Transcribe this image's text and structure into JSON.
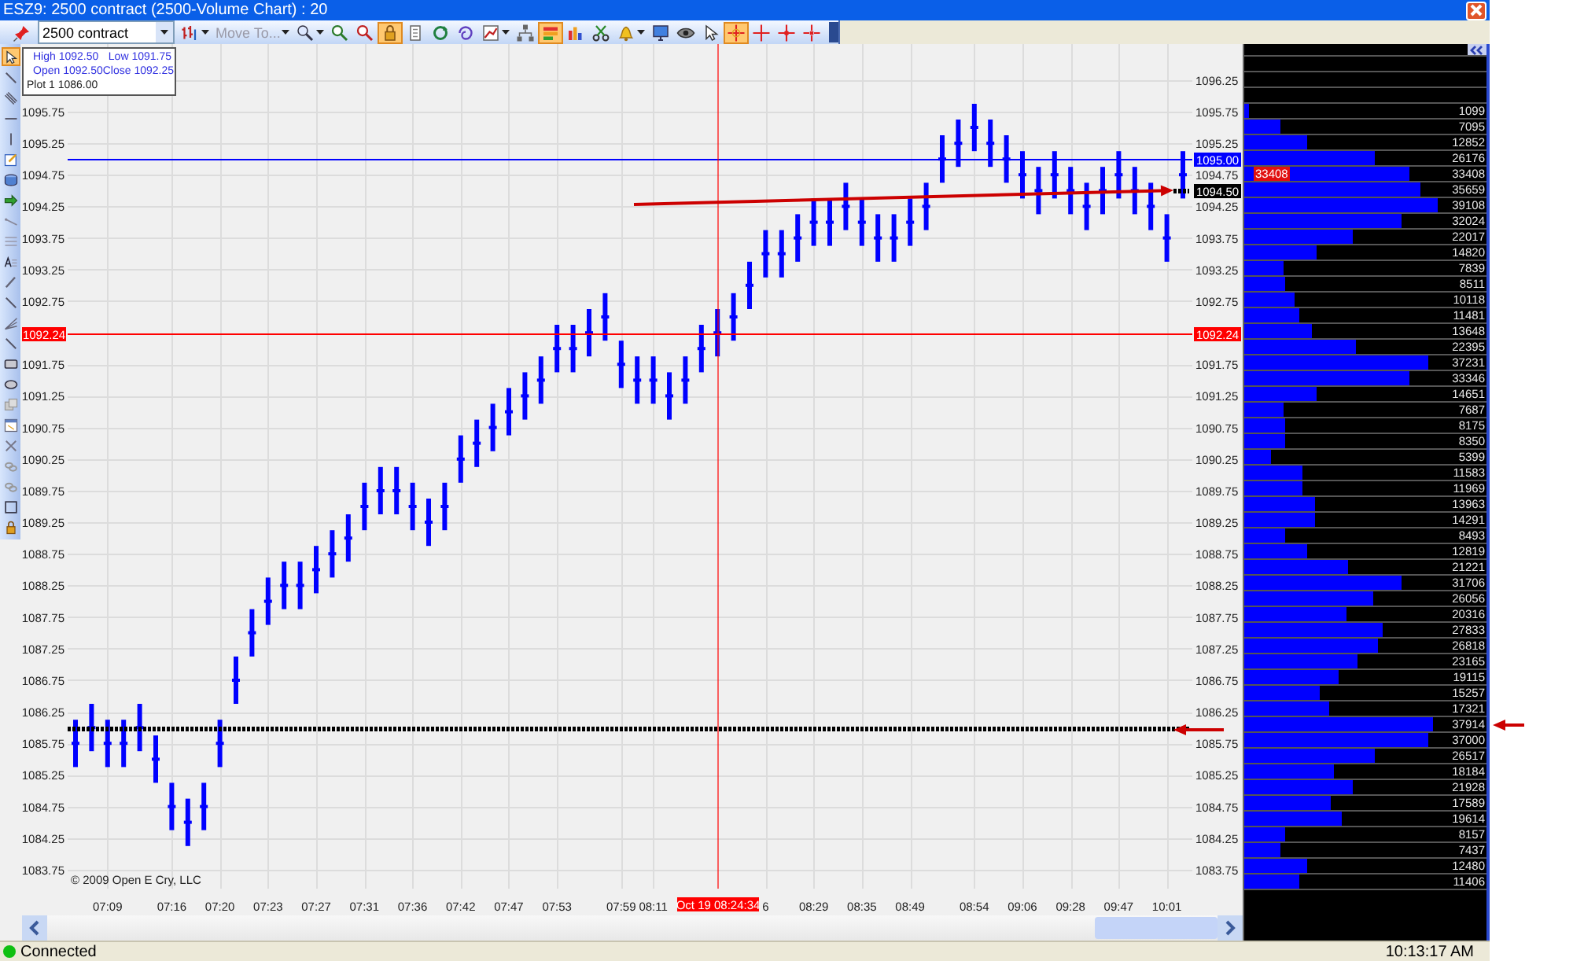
{
  "window": {
    "title": "ESZ9: 2500 contract (2500-Volume Chart) : 20"
  },
  "toolbar": [
    {
      "kind": "pin",
      "selected": false,
      "menu": false
    },
    {
      "kind": "dropdown",
      "value": "2500 contract",
      "menu": true
    },
    {
      "kind": "bars",
      "selected": false,
      "menu": true
    },
    {
      "kind": "move",
      "label": "Move To...",
      "disabled": true,
      "menu": true
    },
    {
      "kind": "zoom",
      "selected": false,
      "menu": true
    },
    {
      "kind": "zoom-in",
      "selected": false,
      "menu": false
    },
    {
      "kind": "zoom-out",
      "selected": false,
      "menu": false
    },
    {
      "kind": "lock",
      "selected": true,
      "menu": false
    },
    {
      "kind": "page",
      "selected": false,
      "menu": false
    },
    {
      "kind": "refresh",
      "selected": false,
      "menu": false
    },
    {
      "kind": "swirl",
      "selected": false,
      "menu": false
    },
    {
      "kind": "chart",
      "selected": false,
      "menu": true
    },
    {
      "kind": "tree",
      "selected": false,
      "menu": false
    },
    {
      "kind": "colorbars",
      "selected": true,
      "menu": false
    },
    {
      "kind": "barchart",
      "selected": false,
      "menu": false
    },
    {
      "kind": "scissors",
      "selected": false,
      "menu": false
    },
    {
      "kind": "bell",
      "selected": false,
      "menu": true
    },
    {
      "kind": "monitor",
      "selected": false,
      "menu": false
    },
    {
      "kind": "eye",
      "selected": false,
      "menu": false
    },
    {
      "kind": "pointer",
      "selected": false,
      "menu": false
    },
    {
      "kind": "crosshair",
      "selected": true,
      "menu": false
    },
    {
      "kind": "cross",
      "selected": false,
      "menu": false
    },
    {
      "kind": "cross-dot",
      "selected": false,
      "menu": false
    },
    {
      "kind": "cross-dash",
      "selected": false,
      "menu": false
    }
  ],
  "left_tools": [
    {
      "kind": "pointer",
      "selected": true
    },
    {
      "kind": "diagonal",
      "selected": false
    },
    {
      "kind": "parallel",
      "selected": false
    },
    {
      "kind": "hline",
      "selected": false
    },
    {
      "kind": "vline",
      "selected": false
    },
    {
      "kind": "note",
      "selected": false
    },
    {
      "kind": "cylinder",
      "selected": false
    },
    {
      "kind": "arrow",
      "selected": false
    },
    {
      "kind": "ray",
      "selected": false
    },
    {
      "kind": "lines",
      "selected": false
    },
    {
      "kind": "text",
      "selected": false
    },
    {
      "kind": "pencil",
      "selected": false
    },
    {
      "kind": "diagonal",
      "selected": false
    },
    {
      "kind": "fan",
      "selected": false
    },
    {
      "kind": "diagonal",
      "selected": false
    },
    {
      "kind": "rectangle",
      "selected": false
    },
    {
      "kind": "ellipse",
      "selected": false
    },
    {
      "kind": "copy",
      "selected": false
    },
    {
      "kind": "window",
      "selected": false
    },
    {
      "kind": "cross-x",
      "selected": false
    },
    {
      "kind": "chain",
      "selected": false
    },
    {
      "kind": "chain",
      "selected": false
    },
    {
      "kind": "square",
      "selected": false
    },
    {
      "kind": "lock",
      "selected": false
    }
  ],
  "info_box": {
    "lines": [
      {
        "kind": "ohlc",
        "items": [
          "High 1092.50",
          "Low 1091.75"
        ]
      },
      {
        "kind": "ohlc",
        "items": [
          "Open 1092.50",
          "Close 1092.25"
        ]
      },
      {
        "kind": "plot",
        "items": [
          "Plot 1 1086.00"
        ]
      }
    ]
  },
  "chart": {
    "copyright": "© 2009 Open E Cry, LLC",
    "left_axis_labels": [
      "1095.75",
      "1095.25",
      "1094.75",
      "1094.25",
      "1093.75",
      "1093.25",
      "1092.75",
      "1091.75",
      "1091.25",
      "1090.75",
      "1090.25",
      "1089.75",
      "1089.25",
      "1088.75",
      "1088.25",
      "1087.75",
      "1087.25",
      "1086.75",
      "1086.25",
      "1085.75",
      "1085.25",
      "1084.75",
      "1084.25",
      "1083.75"
    ],
    "left_marker_label": "1092.24",
    "cursor_label": "Oct 19 08:24:34",
    "chart_data": {
      "type": "scatter",
      "ylim": [
        1083.45,
        1096.82
      ],
      "grid": true,
      "categories": [
        null,
        null,
        "07:09",
        null,
        null,
        null,
        "07:16",
        null,
        null,
        "07:20",
        null,
        null,
        "07:23",
        null,
        null,
        "07:27",
        null,
        null,
        "07:31",
        null,
        null,
        "07:36",
        null,
        null,
        "07:42",
        null,
        null,
        "07:47",
        null,
        null,
        "07:53",
        null,
        null,
        null,
        "07:59",
        null,
        "08:11",
        null,
        null,
        null,
        null,
        null,
        null,
        "6",
        null,
        null,
        "08:29",
        null,
        null,
        "08:35",
        null,
        null,
        "08:49",
        null,
        null,
        null,
        "08:54",
        null,
        null,
        "09:06",
        null,
        null,
        "09:28",
        null,
        null,
        "09:47",
        null,
        null,
        "10:01",
        null
      ],
      "series": [
        {
          "color": "#0000ff",
          "values": [
            1085.75,
            1086,
            1085.75,
            1085.75,
            1086,
            1085.5,
            1084.75,
            1084.5,
            1084.75,
            1085.75,
            1086.75,
            1087.5,
            1088,
            1088.25,
            1088.25,
            1088.5,
            1088.75,
            1089,
            1089.5,
            1089.75,
            1089.75,
            1089.5,
            1089.25,
            1089.5,
            1090.25,
            1090.5,
            1090.75,
            1091,
            1091.25,
            1091.5,
            1092,
            1092,
            1092.25,
            1092.5,
            1091.75,
            1091.5,
            1091.5,
            1091.25,
            1091.5,
            1092,
            1092.25,
            1092.5,
            1093,
            1093.5,
            1093.5,
            1093.75,
            1094,
            1094,
            1094.25,
            1094,
            1093.75,
            1093.75,
            1094,
            1094.25,
            1095,
            1095.25,
            1095.5,
            1095.25,
            1095,
            1094.75,
            1094.5,
            1094.75,
            1094.5,
            1094.25,
            1094.5,
            1094.75,
            1094.5,
            1094.25,
            1093.75,
            1094.75
          ],
          "errors": [
            0.375,
            0.375,
            0.375,
            0.375,
            0.375,
            0.375,
            0.375,
            0.375,
            0.375,
            0.375,
            0.375,
            0.375,
            0.375,
            0.375,
            0.375,
            0.375,
            0.375,
            0.375,
            0.375,
            0.375,
            0.375,
            0.375,
            0.375,
            0.375,
            0.375,
            0.375,
            0.375,
            0.375,
            0.375,
            0.375,
            0.375,
            0.375,
            0.375,
            0.375,
            0.375,
            0.375,
            0.375,
            0.375,
            0.375,
            0.375,
            0.375,
            0.375,
            0.375,
            0.375,
            0.375,
            0.375,
            0.375,
            0.375,
            0.375,
            0.375,
            0.375,
            0.375,
            0.375,
            0.375,
            0.375,
            0.375,
            0.375,
            0.375,
            0.375,
            0.375,
            0.375,
            0.375,
            0.375,
            0.375,
            0.375,
            0.375,
            0.375,
            0.375,
            0.375,
            0.375
          ]
        }
      ],
      "yticks": [
        1096.25,
        1095.75,
        1095.25,
        1094.75,
        1094.25,
        1093.75,
        1093.25,
        1092.75,
        1091.75,
        1091.25,
        1090.75,
        1090.25,
        1089.75,
        1089.25,
        1088.75,
        1088.25,
        1087.75,
        1087.25,
        1086.75,
        1086.25,
        1085.75,
        1085.25,
        1084.75,
        1084.25,
        1083.75
      ],
      "ref_lines": [
        {
          "axis": "y",
          "value": 1095,
          "color": "#0000ff",
          "label": "1095.00"
        },
        {
          "axis": "y",
          "value": 1092.24,
          "color": "#ff0000",
          "label": "1092.24"
        },
        {
          "axis": "y",
          "value": 1086,
          "color": "#000000"
        },
        {
          "axis": "y",
          "value": 1094.5,
          "color": "#000000",
          "label": "1094.50"
        }
      ]
    }
  },
  "volume_profile": {
    "rows": [
      {
        "volume": "1099",
        "level": 0.02,
        "arrow": false
      },
      {
        "volume": "7095",
        "level": 0.15,
        "arrow": false
      },
      {
        "volume": "12852",
        "level": 0.26,
        "arrow": false
      },
      {
        "volume": "26176",
        "level": 0.54,
        "arrow": false
      },
      {
        "volume": "33408",
        "level": 0.68,
        "arrow": false,
        "tag": "33408"
      },
      {
        "volume": "35659",
        "level": 0.73,
        "arrow": false
      },
      {
        "volume": "39108",
        "level": 0.8,
        "arrow": false
      },
      {
        "volume": "32024",
        "level": 0.65,
        "arrow": false
      },
      {
        "volume": "22017",
        "level": 0.45,
        "arrow": false
      },
      {
        "volume": "14820",
        "level": 0.3,
        "arrow": false
      },
      {
        "volume": "7839",
        "level": 0.16,
        "arrow": false
      },
      {
        "volume": "8511",
        "level": 0.17,
        "arrow": false
      },
      {
        "volume": "10118",
        "level": 0.21,
        "arrow": false
      },
      {
        "volume": "11481",
        "level": 0.23,
        "arrow": false
      },
      {
        "volume": "13648",
        "level": 0.28,
        "arrow": false
      },
      {
        "volume": "22395",
        "level": 0.46,
        "arrow": false
      },
      {
        "volume": "37231",
        "level": 0.76,
        "arrow": false
      },
      {
        "volume": "33346",
        "level": 0.68,
        "arrow": false
      },
      {
        "volume": "14651",
        "level": 0.3,
        "arrow": false
      },
      {
        "volume": "7687",
        "level": 0.16,
        "arrow": false
      },
      {
        "volume": "8175",
        "level": 0.17,
        "arrow": false
      },
      {
        "volume": "8350",
        "level": 0.17,
        "arrow": false
      },
      {
        "volume": "5399",
        "level": 0.11,
        "arrow": false
      },
      {
        "volume": "11583",
        "level": 0.24,
        "arrow": false
      },
      {
        "volume": "11969",
        "level": 0.24,
        "arrow": false
      },
      {
        "volume": "13963",
        "level": 0.29,
        "arrow": false
      },
      {
        "volume": "14291",
        "level": 0.29,
        "arrow": false
      },
      {
        "volume": "8493",
        "level": 0.17,
        "arrow": false
      },
      {
        "volume": "12819",
        "level": 0.26,
        "arrow": false
      },
      {
        "volume": "21221",
        "level": 0.43,
        "arrow": false
      },
      {
        "volume": "31706",
        "level": 0.65,
        "arrow": false
      },
      {
        "volume": "26056",
        "level": 0.53,
        "arrow": false
      },
      {
        "volume": "20316",
        "level": 0.42,
        "arrow": false
      },
      {
        "volume": "27833",
        "level": 0.57,
        "arrow": false
      },
      {
        "volume": "26818",
        "level": 0.55,
        "arrow": false
      },
      {
        "volume": "23165",
        "level": 0.47,
        "arrow": false
      },
      {
        "volume": "19115",
        "level": 0.39,
        "arrow": false
      },
      {
        "volume": "15257",
        "level": 0.31,
        "arrow": false
      },
      {
        "volume": "17321",
        "level": 0.35,
        "arrow": false
      },
      {
        "volume": "37914",
        "level": 0.78,
        "arrow": true
      },
      {
        "volume": "37000",
        "level": 0.76,
        "arrow": false
      },
      {
        "volume": "26517",
        "level": 0.54,
        "arrow": false
      },
      {
        "volume": "18184",
        "level": 0.37,
        "arrow": false
      },
      {
        "volume": "21928",
        "level": 0.45,
        "arrow": false
      },
      {
        "volume": "17589",
        "level": 0.36,
        "arrow": false
      },
      {
        "volume": "19614",
        "level": 0.4,
        "arrow": false
      },
      {
        "volume": "8157",
        "level": 0.17,
        "arrow": false
      },
      {
        "volume": "7437",
        "level": 0.15,
        "arrow": false
      },
      {
        "volume": "12480",
        "level": 0.26,
        "arrow": false
      },
      {
        "volume": "11406",
        "level": 0.23,
        "arrow": false
      }
    ]
  },
  "status_bar": {
    "connected": true,
    "status": "Connected",
    "time": "10:13:17 AM"
  }
}
